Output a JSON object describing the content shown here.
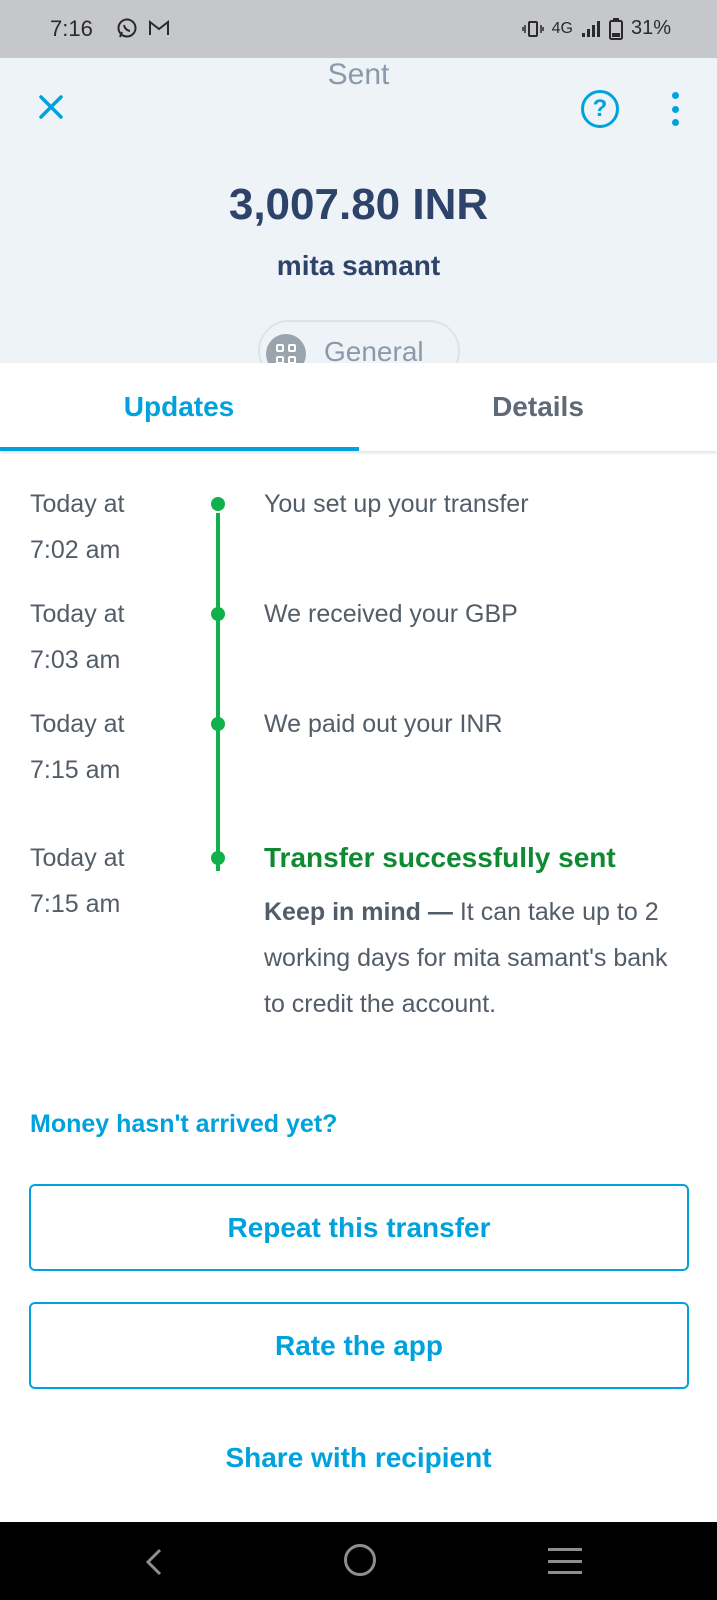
{
  "status_bar": {
    "time": "7:16",
    "network": "4G",
    "battery": "31%",
    "notification_icons": [
      "whatsapp-icon",
      "gmail-icon"
    ]
  },
  "header": {
    "title": "Sent",
    "amount": "3,007.80 INR",
    "recipient": "mita samant",
    "category": "General",
    "icons": {
      "close": "close-icon",
      "help": "?",
      "more": "more-vertical-icon"
    }
  },
  "tabs": [
    {
      "label": "Updates",
      "active": true
    },
    {
      "label": "Details",
      "active": false
    }
  ],
  "timeline": [
    {
      "time_line1": "Today at",
      "time_line2": "7:02 am",
      "text": "You set up your transfer"
    },
    {
      "time_line1": "Today at",
      "time_line2": "7:03 am",
      "text": "We received your GBP"
    },
    {
      "time_line1": "Today at",
      "time_line2": "7:15 am",
      "text": "We paid out your INR"
    },
    {
      "time_line1": "Today at",
      "time_line2": "7:15 am",
      "text": "Transfer successfully sent",
      "note_bold": "Keep in mind —",
      "note": " It can take up to 2 working days for mita samant's bank to credit the account."
    }
  ],
  "actions": {
    "help_link": "Money hasn't arrived yet?",
    "repeat": "Repeat this transfer",
    "rate": "Rate the app",
    "share": "Share with recipient"
  },
  "colors": {
    "accent": "#00a2dd",
    "success": "#10b04a",
    "success_text": "#108a32",
    "heading": "#2e4369",
    "header_bg": "#eef3f7"
  }
}
